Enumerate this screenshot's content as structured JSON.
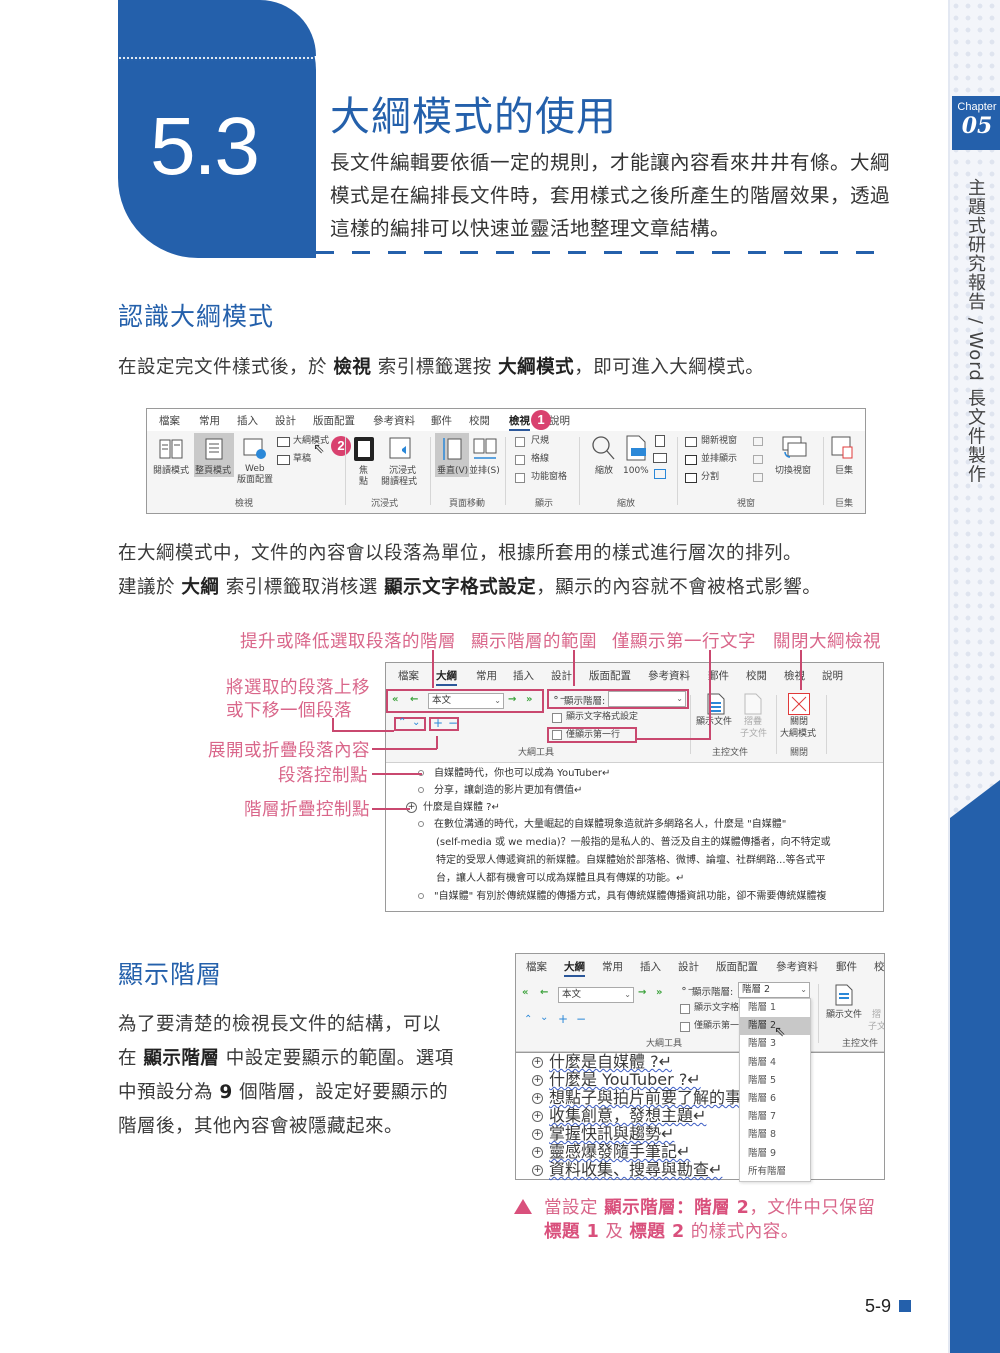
{
  "sidebar": {
    "chapter_label": "Chapter",
    "chapter_number": "05",
    "book_title": "主題式研究報告 / Word 長文件製作"
  },
  "section": {
    "number": "5.3",
    "title": "大綱模式的使用",
    "intro": "長文件編輯要依循一定的規則，才能讓內容看來井井有條。大綱模式是在編排長文件時，套用樣式之後所產生的階層效果，透過這樣的編排可以快速並靈活地整理文章結構。"
  },
  "s1": {
    "heading": "認識大綱模式",
    "p1": {
      "a": "在設定完文件樣式後，於 ",
      "b1": "檢視",
      "c": " 索引標籤選按 ",
      "b2": "大綱模式",
      "d": "，即可進入大綱模式。"
    },
    "p2_line1": "在大綱模式中，文件的內容會以段落為單位，根據所套用的樣式進行層次的排列。",
    "p2_line2": {
      "a": "建議於 ",
      "b1": "大綱",
      "c": " 索引標籤取消核選 ",
      "b2": "顯示文字格式設定",
      "d": "，顯示的內容就不會被格式影響。"
    }
  },
  "ribbon_view": {
    "tabs": [
      "檔案",
      "常用",
      "插入",
      "設計",
      "版面配置",
      "參考資料",
      "郵件",
      "校閱",
      "檢視",
      "說明"
    ],
    "active_tab": "檢視",
    "badge1": "1",
    "badge2": "2",
    "views": {
      "read": "閱讀模式",
      "print": "整頁模式",
      "web1": "Web",
      "web2": "版面配置",
      "outline": "大綱模式",
      "draft": "草稿",
      "group": "檢視"
    },
    "immersive": {
      "focus1": "焦",
      "focus2": "點",
      "reader1": "沉浸式",
      "reader2": "閱讀程式",
      "group": "沉浸式"
    },
    "page_move": {
      "vertical": "垂直(V)",
      "side": "並排(S)",
      "group": "頁面移動"
    },
    "show": {
      "ruler": "尺規",
      "grid": "格線",
      "nav": "功能窗格",
      "group": "顯示"
    },
    "zoom": {
      "zoom": "縮放",
      "percent": "100%",
      "group": "縮放",
      "icon_text": "100"
    },
    "window": {
      "new": "開新視窗",
      "arrange": "並排顯示",
      "split": "分割",
      "switch": "切換視窗",
      "group": "視窗"
    },
    "macros": {
      "label": "巨集",
      "group": "巨集"
    }
  },
  "callouts": {
    "promote": "提升或降低選取段落的階層",
    "show_level": "顯示階層的範圍",
    "first_line": "僅顯示第一行文字",
    "close": "關閉大綱檢視",
    "move1": "將選取的段落上移",
    "move2": "或下移一個段落",
    "expand": "展開或折疊段落內容",
    "para_ctrl": "段落控制點",
    "level_ctrl": "階層折疊控制點"
  },
  "outline_ribbon": {
    "tabs": [
      "檔案",
      "大綱",
      "常用",
      "插入",
      "設計",
      "版面配置",
      "參考資料",
      "郵件",
      "校閱",
      "檢視",
      "說明"
    ],
    "active_tab": "大綱",
    "level_value": "本文",
    "show_level_label": "顯示階層:",
    "show_level_value": "",
    "show_format": "顯示文字格式設定",
    "first_line_only": "僅顯示第一行",
    "tools_group": "大綱工具",
    "show_doc": "顯示文件",
    "collapse1": "摺疊",
    "collapse2": "子文件",
    "master_group": "主控文件",
    "close1": "關閉",
    "close2": "大綱模式",
    "close_group": "關閉"
  },
  "outline_doc": {
    "lines": [
      {
        "type": "bullet",
        "text": "自媒體時代，你也可以成為 YouTuber↵"
      },
      {
        "type": "bullet",
        "text": "分享，讓創造的影片更加有價值↵"
      },
      {
        "type": "plus",
        "text": "什麼是自媒體 ?↵"
      },
      {
        "type": "bullet",
        "text": "在數位溝通的時代，大量崛起的自媒體現象造就許多網路名人，什麼是 \"自媒體\""
      },
      {
        "type": "cont",
        "text": "(self-media 或 we media)？一般指的是私人的、普泛及自主的媒體傳播者，向不特定或"
      },
      {
        "type": "cont",
        "text": "特定的受眾人傳遞資訊的新媒體。自媒體始於部落格、微博、論壇、社群網路...等各式平"
      },
      {
        "type": "cont",
        "text": "台，讓人人都有機會可以成為媒體且具有傳媒的功能。↵"
      },
      {
        "type": "bullet",
        "text": "\"自媒體\" 有別於傳統媒體的傳播方式，具有傳統媒體傳播資訊功能，卻不需要傳統媒體複"
      }
    ]
  },
  "s2": {
    "heading": "顯示階層",
    "body": [
      {
        "a": "為了要清楚的檢視長文件的結構，可以"
      },
      {
        "a": "在 ",
        "b": "顯示階層",
        "c": " 中設定要顯示的範圍。選項"
      },
      {
        "a": "中預設分為 ",
        "b": "9",
        "c": " 個階層，設定好要顯示的"
      },
      {
        "a": "階層後，其他內容會被隱藏起來。"
      }
    ]
  },
  "fig3": {
    "tabs": [
      "檔案",
      "大綱",
      "常用",
      "插入",
      "設計",
      "版面配置",
      "參考資料",
      "郵件",
      "校"
    ],
    "level_value": "本文",
    "show_level_label": "顯示階層:",
    "show_level_value": "階層 2",
    "show_format": "顯示文字格",
    "first_line": "僅顯示第一",
    "tools_group": "大綱工具",
    "show_doc": "顯示文件",
    "collapse": "摺",
    "sub": "子文",
    "master_group": "主控文件",
    "dropdown_options": [
      "階層 1",
      "階層 2",
      "階層 3",
      "階層 4",
      "階層 5",
      "階層 6",
      "階層 7",
      "階層 8",
      "階層 9",
      "所有階層"
    ],
    "selected_option": "階層 2",
    "headings": [
      "什麼是自媒體 ?↵",
      "什麼是 YouTuber ?↵",
      "想點子與拍片前要了解的事↵",
      "收集創意，發想主題↵",
      "掌握快訊與趨勢↵",
      "靈感爆發隨手筆記↵",
      "資料收集、搜尋與勘查↵"
    ]
  },
  "caption": {
    "a": "當設定 ",
    "b1": "顯示階層：階層 2",
    "c": "，文件中只保留",
    "b2": "標題 1",
    "d": " 及 ",
    "b3": "標題 2",
    "e": " 的樣式內容。"
  },
  "page": {
    "number": "5-9"
  },
  "colors": {
    "brand_blue": "#2460ab",
    "callout_pink": "#d9668a",
    "badge_pink": "#d9416f"
  }
}
